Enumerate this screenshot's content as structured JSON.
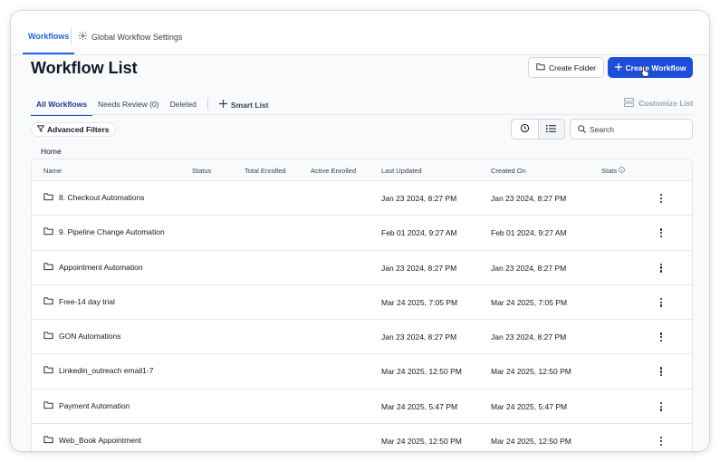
{
  "topbar": {
    "tabs": [
      {
        "label": "Workflows"
      },
      {
        "label": "Global Workflow Settings",
        "icon": "gear-icon"
      }
    ]
  },
  "page": {
    "title": "Workflow List"
  },
  "actions": {
    "create_folder_label": "Create Folder",
    "create_workflow_label": "Create Workflow"
  },
  "subtabs": {
    "all": "All Workflows",
    "review": "Needs Review (0)",
    "deleted": "Deleted",
    "smart_list": "Smart List",
    "customize": "Customize List"
  },
  "filters": {
    "advanced_label": "Advanced Filters",
    "search_placeholder": "Search"
  },
  "breadcrumb": "Home",
  "table": {
    "columns": [
      "Name",
      "Status",
      "Total Enrolled",
      "Active Enrolled",
      "Last Updated",
      "Created On",
      "Stats"
    ],
    "rows": [
      {
        "name": "8. Checkout Automations",
        "updated": "Jan 23 2024, 8:27 PM",
        "created": "Jan 23 2024, 8:27 PM"
      },
      {
        "name": "9. Pipeline Change Automation",
        "updated": "Feb 01 2024, 9:27 AM",
        "created": "Feb 01 2024, 9:27 AM"
      },
      {
        "name": "Appointment Automation",
        "updated": "Jan 23 2024, 8:27 PM",
        "created": "Jan 23 2024, 8:27 PM"
      },
      {
        "name": "Free-14 day trial",
        "updated": "Mar 24 2025, 7:05 PM",
        "created": "Mar 24 2025, 7:05 PM"
      },
      {
        "name": "GON Automations",
        "updated": "Jan 23 2024, 8:27 PM",
        "created": "Jan 23 2024, 8:27 PM"
      },
      {
        "name": "Linkedin_outreach email1-7",
        "updated": "Mar 24 2025, 12:50 PM",
        "created": "Mar 24 2025, 12:50 PM"
      },
      {
        "name": "Payment Automation",
        "updated": "Mar 24 2025, 5:47 PM",
        "created": "Mar 24 2025, 5:47 PM"
      },
      {
        "name": "Web_Book Appointment",
        "updated": "Mar 24 2025, 12:50 PM",
        "created": "Mar 24 2025, 12:50 PM"
      }
    ]
  },
  "colors": {
    "accent": "#1d4ed8",
    "tab_active": "#2563eb"
  }
}
